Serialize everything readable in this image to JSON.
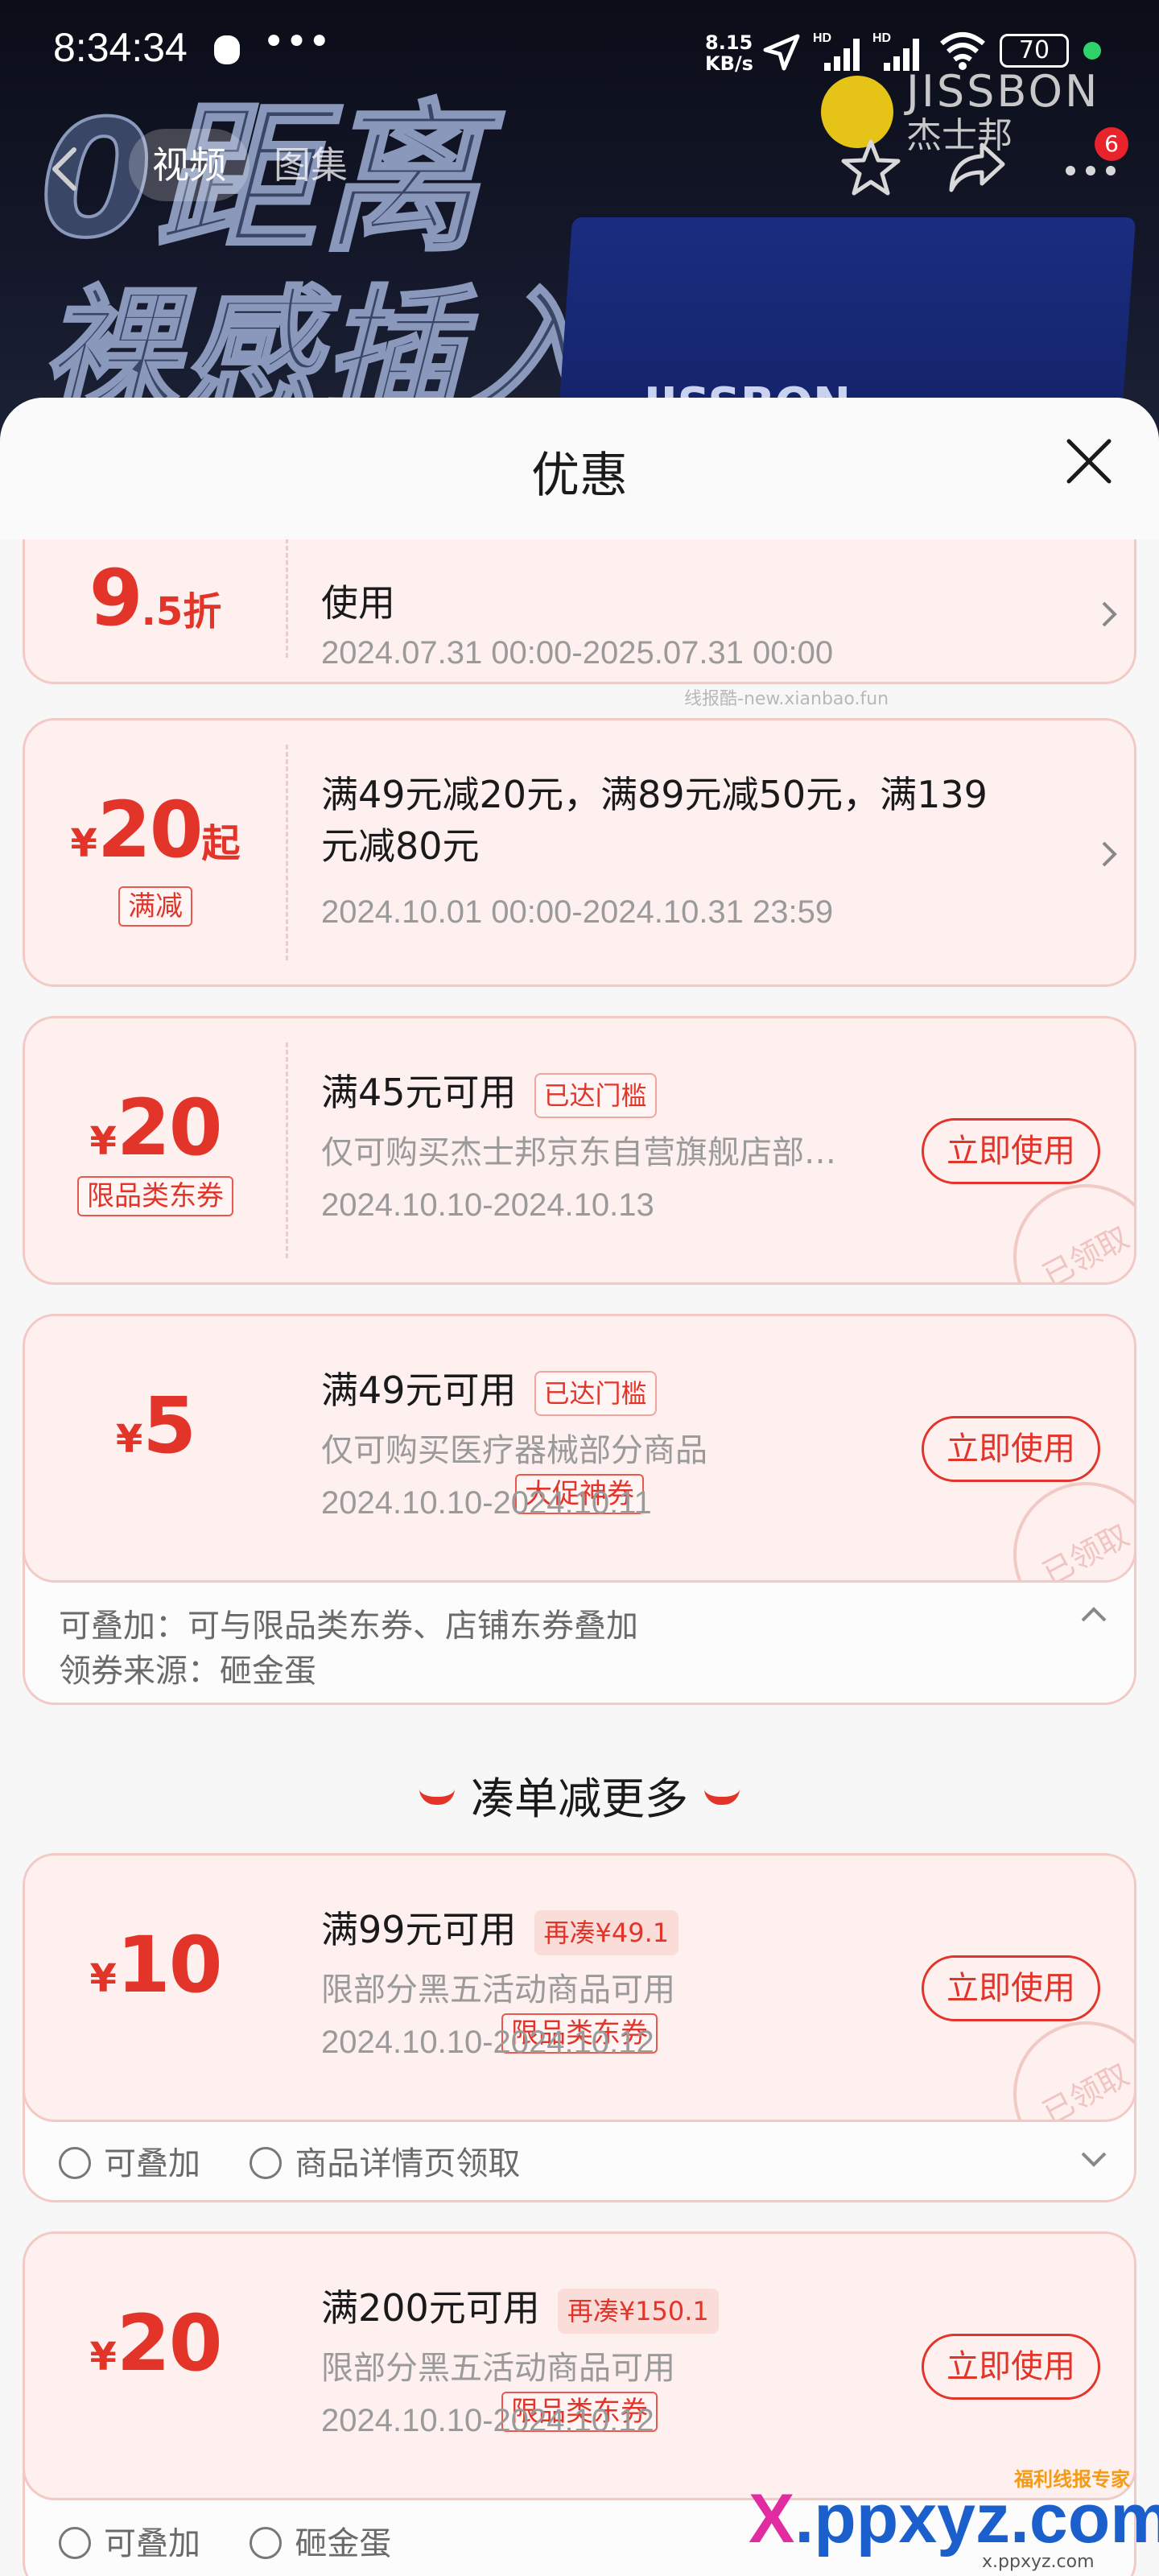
{
  "status_bar": {
    "time": "8:34:34",
    "dots": "•••",
    "speed_value": "8.15",
    "speed_unit": "KB/s",
    "battery": "70"
  },
  "hero": {
    "headline_1": "0距离",
    "headline_2": "裸感插入",
    "brand_en": "JISSBON",
    "brand_cn": "杰士邦",
    "box_logo": "JISSBON"
  },
  "topnav": {
    "tab_video": "视频",
    "tab_gallery": "图集",
    "more_badge": "6"
  },
  "sheet": {
    "title": "优惠"
  },
  "coupons": [
    {
      "amount": "9",
      "amount_suffix": ".5折",
      "title": "使用",
      "date": "2024.07.31 00:00-2025.07.31 00:00"
    },
    {
      "yen": "¥",
      "amount": "20",
      "amount_suffix": "起",
      "tag": "满减",
      "title": "满49元减20元，满89元减50元，满139元减80元",
      "date": "2024.10.01 00:00-2024.10.31 23:59"
    },
    {
      "yen": "¥",
      "amount": "20",
      "tag": "限品类东券",
      "title": "满45元可用",
      "badge": "已达门槛",
      "desc": "仅可购买杰士邦京东自营旗舰店部…",
      "date": "2024.10.10-2024.10.13",
      "button": "立即使用",
      "stamp": "已领取"
    },
    {
      "yen": "¥",
      "amount": "5",
      "tag": "大促神券",
      "title": "满49元可用",
      "badge": "已达门槛",
      "desc": "仅可购买医疗器械部分商品",
      "date": "2024.10.10-2024.10.11",
      "button": "立即使用",
      "stamp": "已领取",
      "ext_line_1": "可叠加：可与限品类东券、店铺东券叠加",
      "ext_line_2": "领券来源：砸金蛋"
    }
  ],
  "section": {
    "title": "凑单减更多"
  },
  "more_coupons": [
    {
      "yen": "¥",
      "amount": "10",
      "tag": "限品类东券",
      "title": "满99元可用",
      "badge": "再凑¥49.1",
      "desc": "限部分黑五活动商品可用",
      "date": "2024.10.10-2024.10.12",
      "button": "立即使用",
      "stamp": "已领取",
      "ext_a": "可叠加",
      "ext_b": "商品详情页领取"
    },
    {
      "yen": "¥",
      "amount": "20",
      "tag": "限品类东券",
      "title": "满200元可用",
      "badge": "再凑¥150.1",
      "desc": "限部分黑五活动商品可用",
      "date": "2024.10.10-2024.10.12",
      "button": "立即使用",
      "ext_a": "可叠加",
      "ext_b": "砸金蛋"
    }
  ],
  "watermarks": {
    "small": "线报酷-new.xianbao.fun",
    "logo_main_1": "X",
    "logo_main_2": ".ppxyz.com",
    "logo_small": "x.ppxyz.com",
    "logo_tiny": "福利线报专家"
  },
  "colors": {
    "accent": "#e3342a",
    "coupon_bg": "#fdf0ef",
    "coupon_border": "#f3c9c5"
  }
}
